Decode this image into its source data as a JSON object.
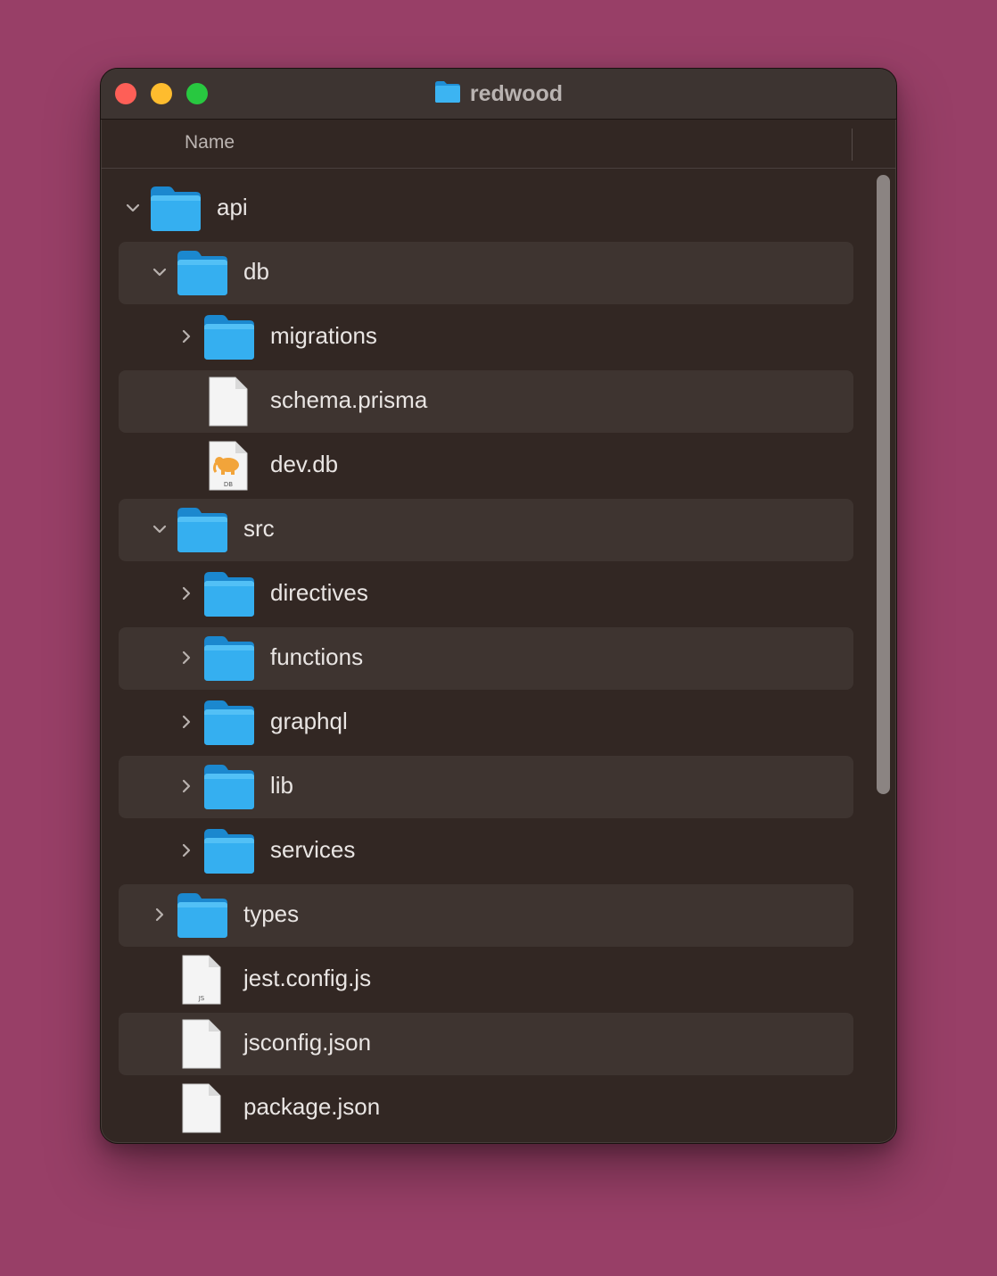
{
  "window": {
    "title": "redwood",
    "title_icon": "folder-icon"
  },
  "columns": {
    "name": "Name"
  },
  "colors": {
    "desktop": "#983f67",
    "window_bg": "#322723",
    "row_alt": "#3e3430",
    "folder_blue": "#29a6ea",
    "close": "#fe5f57",
    "minimize": "#febc2e",
    "zoom": "#28c840"
  },
  "rows": [
    {
      "label": "api",
      "depth": 0,
      "kind": "folder",
      "state": "expanded"
    },
    {
      "label": "db",
      "depth": 1,
      "kind": "folder",
      "state": "expanded"
    },
    {
      "label": "migrations",
      "depth": 2,
      "kind": "folder",
      "state": "collapsed"
    },
    {
      "label": "schema.prisma",
      "depth": 2,
      "kind": "file",
      "state": "none"
    },
    {
      "label": "dev.db",
      "depth": 2,
      "kind": "db-file",
      "state": "none",
      "badge": "DB"
    },
    {
      "label": "src",
      "depth": 1,
      "kind": "folder",
      "state": "expanded"
    },
    {
      "label": "directives",
      "depth": 2,
      "kind": "folder",
      "state": "collapsed"
    },
    {
      "label": "functions",
      "depth": 2,
      "kind": "folder",
      "state": "collapsed"
    },
    {
      "label": "graphql",
      "depth": 2,
      "kind": "folder",
      "state": "collapsed"
    },
    {
      "label": "lib",
      "depth": 2,
      "kind": "folder",
      "state": "collapsed"
    },
    {
      "label": "services",
      "depth": 2,
      "kind": "folder",
      "state": "collapsed"
    },
    {
      "label": "types",
      "depth": 1,
      "kind": "folder",
      "state": "collapsed"
    },
    {
      "label": "jest.config.js",
      "depth": 1,
      "kind": "js-file",
      "state": "none",
      "badge": "JS"
    },
    {
      "label": "jsconfig.json",
      "depth": 1,
      "kind": "file",
      "state": "none"
    },
    {
      "label": "package.json",
      "depth": 1,
      "kind": "file",
      "state": "none"
    }
  ]
}
